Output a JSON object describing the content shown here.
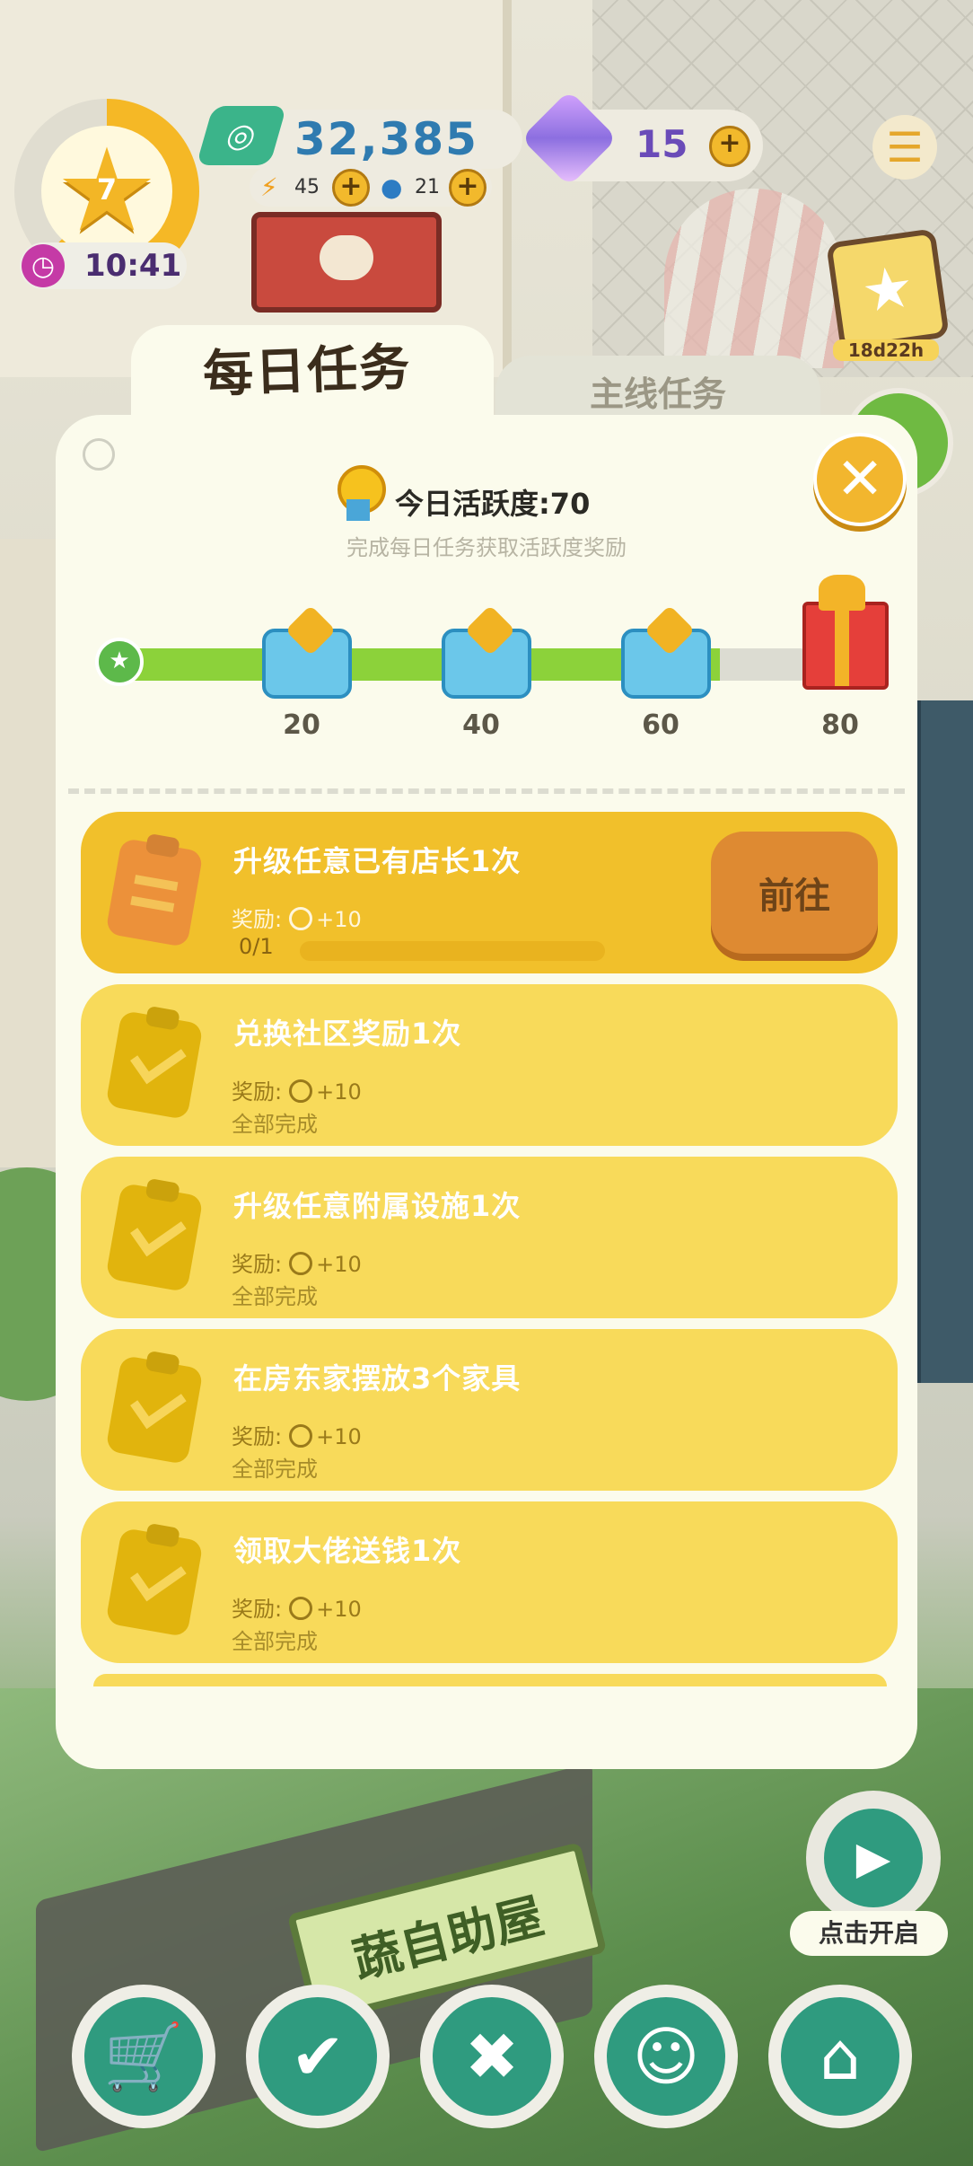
{
  "hud": {
    "level": "7",
    "timer": "10:41",
    "money": "32,385",
    "energy": "45",
    "water": "21",
    "gems": "15",
    "event_timer": "18d22h"
  },
  "tabs": {
    "daily": "每日任务",
    "main": "主线任务"
  },
  "activity": {
    "title": "今日活跃度:70",
    "subtitle": "完成每日任务获取活跃度奖励",
    "current": 70,
    "max": 80,
    "milestones": [
      "20",
      "40",
      "60",
      "80"
    ]
  },
  "tasks": [
    {
      "title": "升级任意已有店长1次",
      "reward_label": "奖励:",
      "reward_value": "+10",
      "status": "0/1",
      "button": "前往",
      "active": true
    },
    {
      "title": "兑换社区奖励1次",
      "reward_label": "奖励:",
      "reward_value": "+10",
      "status": "全部完成"
    },
    {
      "title": "升级任意附属设施1次",
      "reward_label": "奖励:",
      "reward_value": "+10",
      "status": "全部完成"
    },
    {
      "title": "在房东家摆放3个家具",
      "reward_label": "奖励:",
      "reward_value": "+10",
      "status": "全部完成"
    },
    {
      "title": "领取大佬送钱1次",
      "reward_label": "奖励:",
      "reward_value": "+10",
      "status": "全部完成"
    }
  ],
  "bottom": {
    "tv_label": "点击开启",
    "store_sign": "蔬自助屋"
  },
  "colors": {
    "panel": "#fbfbec",
    "task": "#f8da5a",
    "task_active": "#f1c02b",
    "progress": "#8cd23a",
    "accent": "#f2b62e"
  },
  "icons": {
    "level": "star-icon",
    "timer": "clock-icon",
    "money": "cash-icon",
    "energy": "lightning-icon",
    "water": "water-drop-icon",
    "gem": "gem-icon",
    "menu": "menu-icon",
    "close": "close-icon",
    "nav": [
      "cart-icon",
      "task-check-icon",
      "tools-icon",
      "smile-icon",
      "home-icon"
    ]
  }
}
